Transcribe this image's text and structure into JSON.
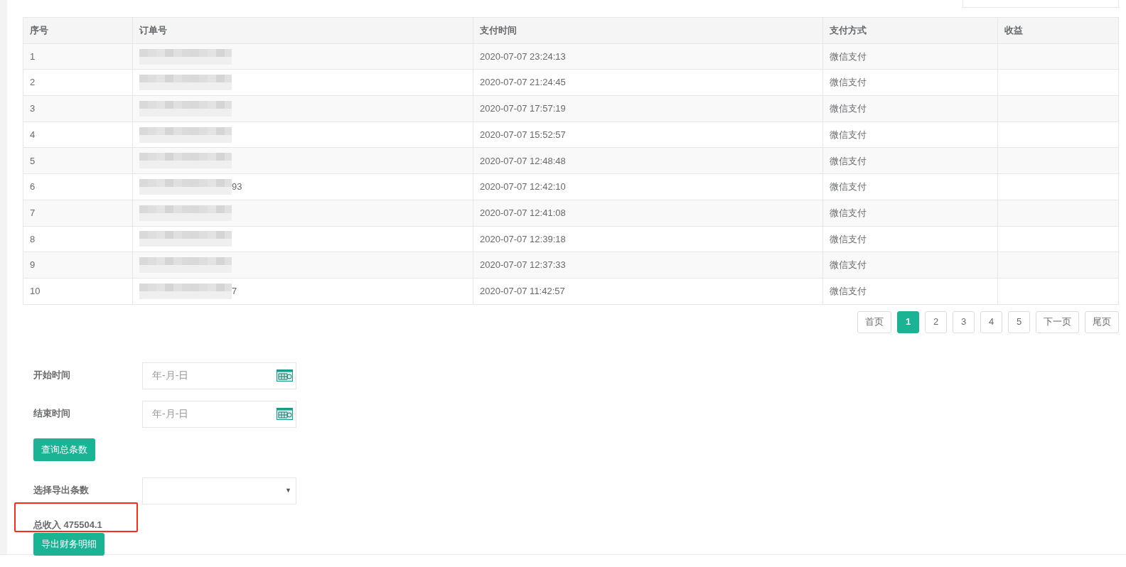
{
  "search": {
    "kind": "field"
  },
  "table": {
    "columns": [
      "序号",
      "订单号",
      "支付时间",
      "支付方式",
      "收益"
    ],
    "rows": [
      {
        "index": "1",
        "order_tail": "",
        "paid_at": "2020-07-07 23:24:13",
        "method": "微信支付"
      },
      {
        "index": "2",
        "order_tail": "",
        "paid_at": "2020-07-07 21:24:45",
        "method": "微信支付"
      },
      {
        "index": "3",
        "order_tail": "",
        "paid_at": "2020-07-07 17:57:19",
        "method": "微信支付"
      },
      {
        "index": "4",
        "order_tail": "",
        "paid_at": "2020-07-07 15:52:57",
        "method": "微信支付"
      },
      {
        "index": "5",
        "order_tail": "",
        "paid_at": "2020-07-07 12:48:48",
        "method": "微信支付"
      },
      {
        "index": "6",
        "order_tail": "93",
        "paid_at": "2020-07-07 12:42:10",
        "method": "微信支付"
      },
      {
        "index": "7",
        "order_tail": "",
        "paid_at": "2020-07-07 12:41:08",
        "method": "微信支付"
      },
      {
        "index": "8",
        "order_tail": "",
        "paid_at": "2020-07-07 12:39:18",
        "method": "微信支付"
      },
      {
        "index": "9",
        "order_tail": "",
        "paid_at": "2020-07-07 12:37:33",
        "method": "微信支付"
      },
      {
        "index": "10",
        "order_tail": "7",
        "paid_at": "2020-07-07 11:42:57",
        "method": "微信支付"
      }
    ]
  },
  "pagination": [
    {
      "label": "首页",
      "selected": false
    },
    {
      "label": "1",
      "selected": true
    },
    {
      "label": "2",
      "selected": false
    },
    {
      "label": "3",
      "selected": false
    },
    {
      "label": "4",
      "selected": false
    },
    {
      "label": "5",
      "selected": false
    },
    {
      "label": "下一页",
      "selected": false
    },
    {
      "label": "尾页",
      "selected": false
    }
  ],
  "form": {
    "start": {
      "label": "开始时间",
      "placeholder": "年-月-日"
    },
    "end": {
      "label": "结束时间",
      "placeholder": "年-月-日"
    },
    "query_button": "查询总条数",
    "export_count": {
      "label": "选择导出条数",
      "caret": "▼"
    },
    "total": "总收入 475504.1",
    "export_button": "导出财务明细"
  }
}
